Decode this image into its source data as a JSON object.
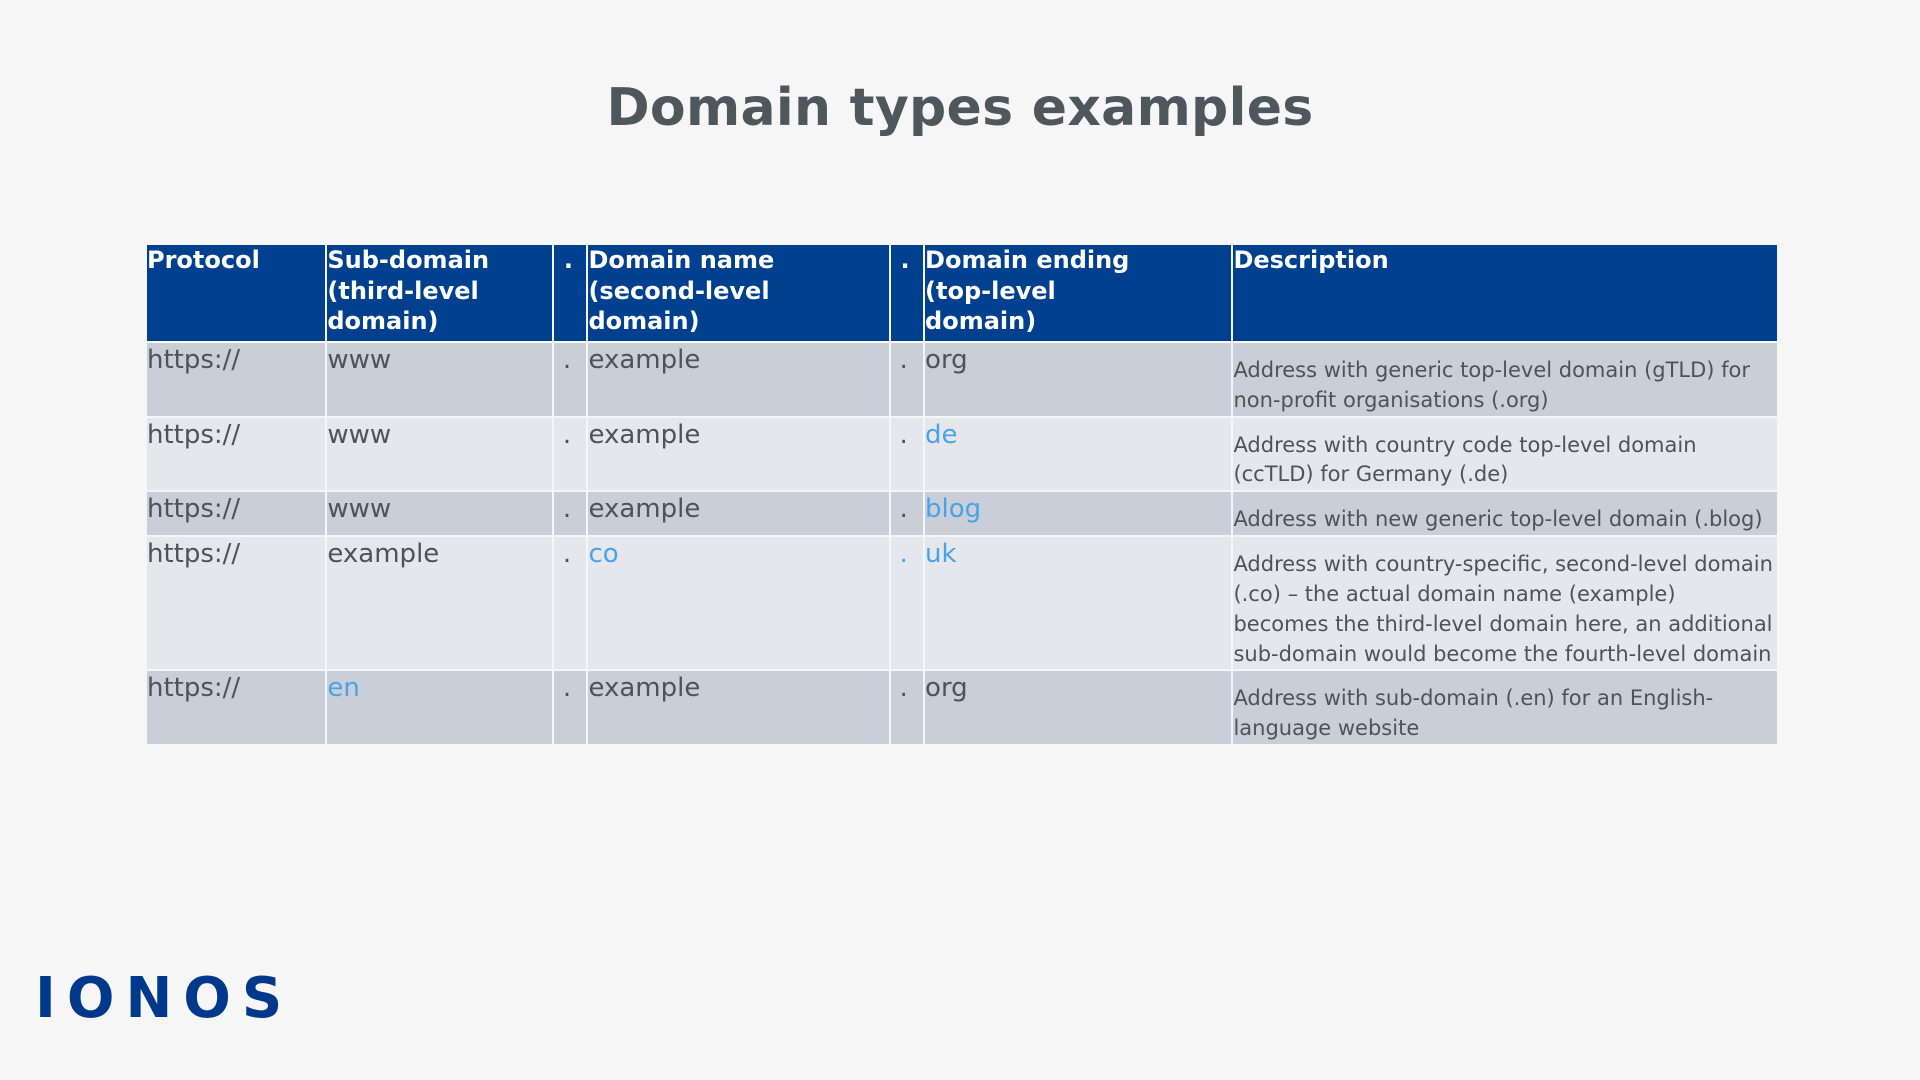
{
  "page": {
    "title": "Domain types examples",
    "background_color": "#f6f6f7",
    "title_color": "#4e575b"
  },
  "brand": {
    "logo_text": "IONOS",
    "logo_color": "#00398c"
  },
  "theme": {
    "header_bg": "#00408f",
    "header_text": "#ffffff",
    "row_dark_bg": "#c9ced9",
    "row_light_bg": "#e5e7ec",
    "body_text": "#4b545a",
    "accent_blue": "#4aa3e8"
  },
  "table": {
    "headers": [
      "Protocol",
      "Sub-domain (third-level domain)",
      ".",
      "Domain name (second-level domain)",
      ".",
      "Domain ending (top-level domain)",
      "Description"
    ],
    "headers_lines": {
      "protocol": [
        "Protocol"
      ],
      "subdomain": [
        "Sub-domain",
        "(third-level",
        "domain)"
      ],
      "dot1": [
        "."
      ],
      "domain_name": [
        "Domain name",
        "(second-level",
        "domain)"
      ],
      "dot2": [
        "."
      ],
      "domain_ending": [
        "Domain ending",
        "(top-level",
        "domain)"
      ],
      "description": [
        "Description"
      ]
    },
    "rows": [
      {
        "protocol": "https://",
        "subdomain": "www",
        "dot1": ".",
        "domain_name": "example",
        "dot2": ".",
        "domain_ending": "org",
        "description": "Address with generic top-level domain (gTLD) for non-profit organisations (.org)",
        "highlight": "none",
        "shade": "dark"
      },
      {
        "protocol": "https://",
        "subdomain": "www",
        "dot1": ".",
        "domain_name": "example",
        "dot2": ".",
        "domain_ending": "de",
        "description": "Address with country code top-level domain (ccTLD) for Germany (.de)",
        "highlight": "domain_ending",
        "shade": "light"
      },
      {
        "protocol": "https://",
        "subdomain": "www",
        "dot1": ".",
        "domain_name": "example",
        "dot2": ".",
        "domain_ending": "blog",
        "description": "Address with new generic top-level domain (.blog)",
        "highlight": "domain_ending",
        "shade": "dark"
      },
      {
        "protocol": "https://",
        "subdomain": "example",
        "dot1": ".",
        "domain_name": "co",
        "dot2": ".",
        "domain_ending": "uk",
        "description": "Address with country-specific, second-level domain (.co) – the actual domain name (example) becomes the third-level domain here, an additional sub-domain would become the fourth-level domain",
        "highlight": "domain_name_dot2_ending",
        "shade": "light"
      },
      {
        "protocol": "https://",
        "subdomain": "en",
        "dot1": ".",
        "domain_name": "example",
        "dot2": ".",
        "domain_ending": "org",
        "description": "Address with sub-domain (.en) for an English-language website",
        "highlight": "subdomain",
        "shade": "dark"
      }
    ]
  }
}
